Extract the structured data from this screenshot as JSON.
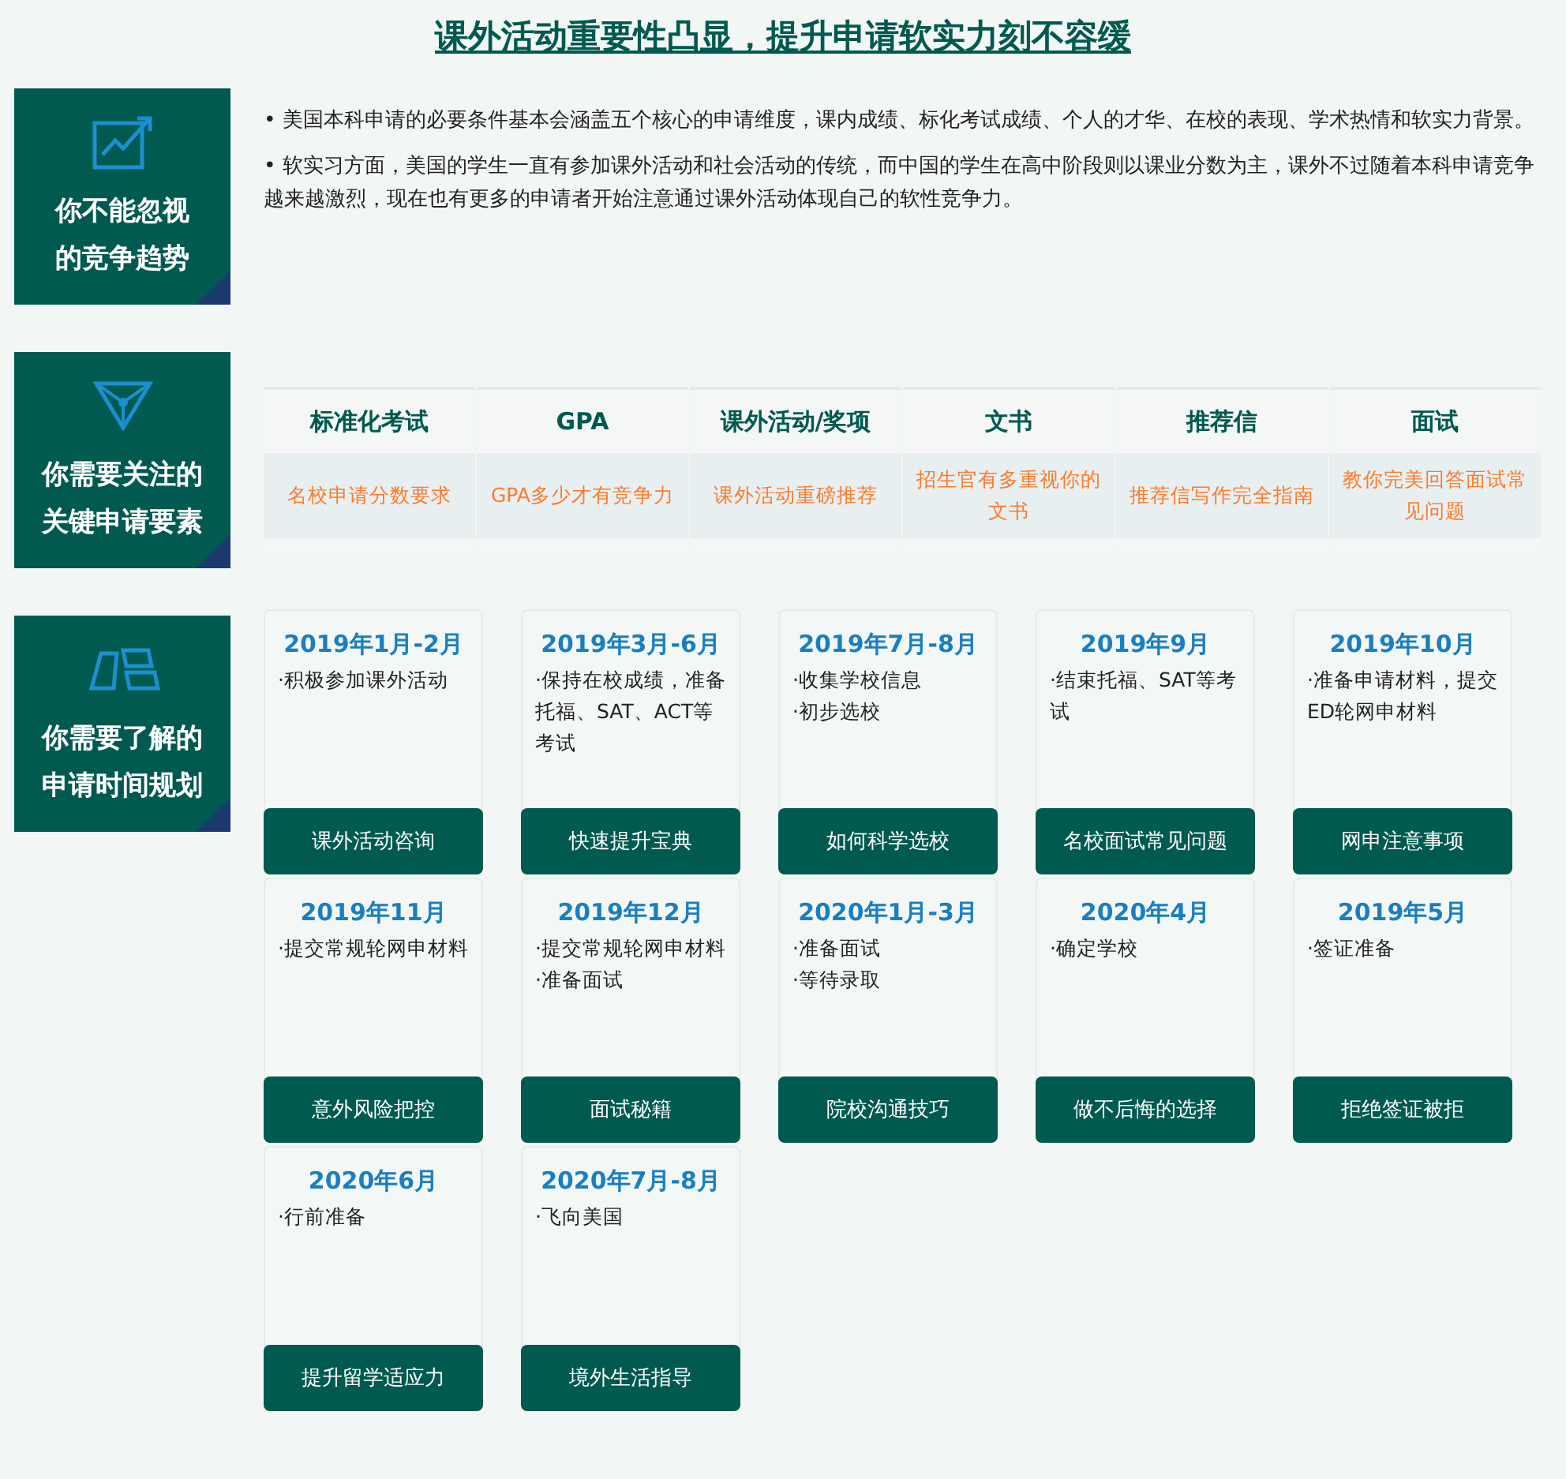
{
  "title": "课外活动重要性凸显，提升申请软实力刻不容缓",
  "sections": [
    {
      "kind": "text",
      "badge": {
        "lines": [
          "你不能忽视",
          "的竞争趋势"
        ]
      },
      "paragraphs": [
        "• 美国本科申请的必要条件基本会涵盖五个核心的申请维度，课内成绩、标化考试成绩、个人的才华、在校的表现、学术热情和软实力背景。",
        "• 软实习方面，美国的学生一直有参加课外活动和社会活动的传统，而中国的学生在高中阶段则以课业分数为主，课外不过随着本科申请竞争越来越激烈，现在也有更多的申请者开始注意通过课外活动体现自己的软性竞争力。"
      ]
    },
    {
      "kind": "table",
      "badge": {
        "lines": [
          "你需要关注的",
          "关键申请要素"
        ]
      },
      "columns": [
        {
          "heading": "标准化考试",
          "link": "名校申请分数要求"
        },
        {
          "heading": "GPA",
          "link": "GPA多少才有竞争力"
        },
        {
          "heading": "课外活动/奖项",
          "link": "课外活动重磅推荐"
        },
        {
          "heading": "文书",
          "link": "招生官有多重视你的文书"
        },
        {
          "heading": "推荐信",
          "link": "推荐信写作完全指南"
        },
        {
          "heading": "面试",
          "link": "教你完美回答面试常见问题"
        }
      ]
    },
    {
      "kind": "timeline",
      "badge": {
        "lines": [
          "你需要了解的",
          "申请时间规划"
        ]
      },
      "cards": [
        {
          "date": "2019年1月-2月",
          "items": [
            "·积极参加课外活动"
          ],
          "button": "课外活动咨询"
        },
        {
          "date": "2019年3月-6月",
          "items": [
            "·保持在校成绩，准备托福、SAT、ACT等考试"
          ],
          "button": "快速提升宝典"
        },
        {
          "date": "2019年7月-8月",
          "items": [
            "·收集学校信息",
            "·初步选校"
          ],
          "button": "如何科学选校"
        },
        {
          "date": "2019年9月",
          "items": [
            "·结束托福、SAT等考试"
          ],
          "button": "名校面试常见问题"
        },
        {
          "date": "2019年10月",
          "items": [
            "·准备申请材料，提交ED轮网申材料"
          ],
          "button": "网申注意事项"
        },
        {
          "date": "2019年11月",
          "items": [
            "·提交常规轮网申材料"
          ],
          "button": "意外风险把控"
        },
        {
          "date": "2019年12月",
          "items": [
            "·提交常规轮网申材料",
            "·准备面试"
          ],
          "button": "面试秘籍"
        },
        {
          "date": "2020年1月-3月",
          "items": [
            "·准备面试",
            "·等待录取"
          ],
          "button": "院校沟通技巧"
        },
        {
          "date": "2020年4月",
          "items": [
            "·确定学校"
          ],
          "button": "做不后悔的选择"
        },
        {
          "date": "2019年5月",
          "items": [
            "·签证准备"
          ],
          "button": "拒绝签证被拒"
        },
        {
          "date": "2020年6月",
          "items": [
            "·行前准备"
          ],
          "button": "提升留学适应力"
        },
        {
          "date": "2020年7月-8月",
          "items": [
            "·飞向美国"
          ],
          "button": "境外生活指导"
        }
      ]
    }
  ]
}
